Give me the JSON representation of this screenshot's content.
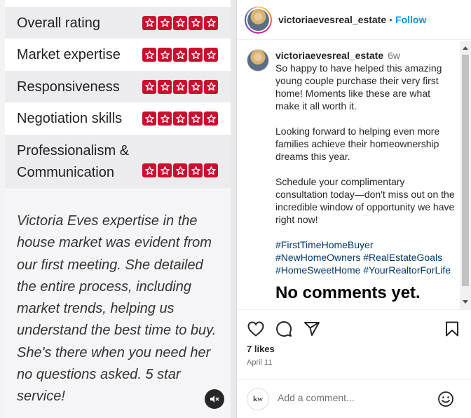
{
  "review_card": {
    "ratings": [
      {
        "label": "Overall rating",
        "stars": 5
      },
      {
        "label": "Market expertise",
        "stars": 5
      },
      {
        "label": "Responsiveness",
        "stars": 5
      },
      {
        "label": "Negotiation skills",
        "stars": 5
      },
      {
        "label_line1": "Professionalism &",
        "label_line2": "Communication",
        "stars": 5
      }
    ],
    "quote": "Victoria Eves expertise in the house market was evident from our first meeting. She detailed the entire process, including market trends, helping us understand the best time to buy. She's there when you need her no questions asked. 5 star service!",
    "star_color": "#c8102e"
  },
  "post": {
    "header": {
      "username": "victoriaevesreal_estate",
      "separator": "•",
      "follow_label": "Follow"
    },
    "caption": {
      "username": "victoriaevesreal_estate",
      "time_ago": "6w",
      "para1": "So happy to have helped this amazing young couple purchase their very first home! Moments like these are what make it all worth it.",
      "para2": "Looking forward to helping even more families achieve their homeownership dreams this year.",
      "para3": "Schedule your complimentary consultation today—don't miss out on the incredible window of opportunity we have right now!",
      "hashtags": [
        "#FirstTimeHomeBuyer",
        "#NewHomeOwners #RealEstateGoals",
        "#HomeSweetHome #YourRealtorForLife"
      ]
    },
    "no_comments": "No comments yet.",
    "likes": "7 likes",
    "date": "April 11",
    "comment": {
      "avatar_text": "kw",
      "placeholder": "Add a comment..."
    },
    "colors": {
      "link": "#0095f6",
      "hashtag": "#00376b"
    }
  }
}
